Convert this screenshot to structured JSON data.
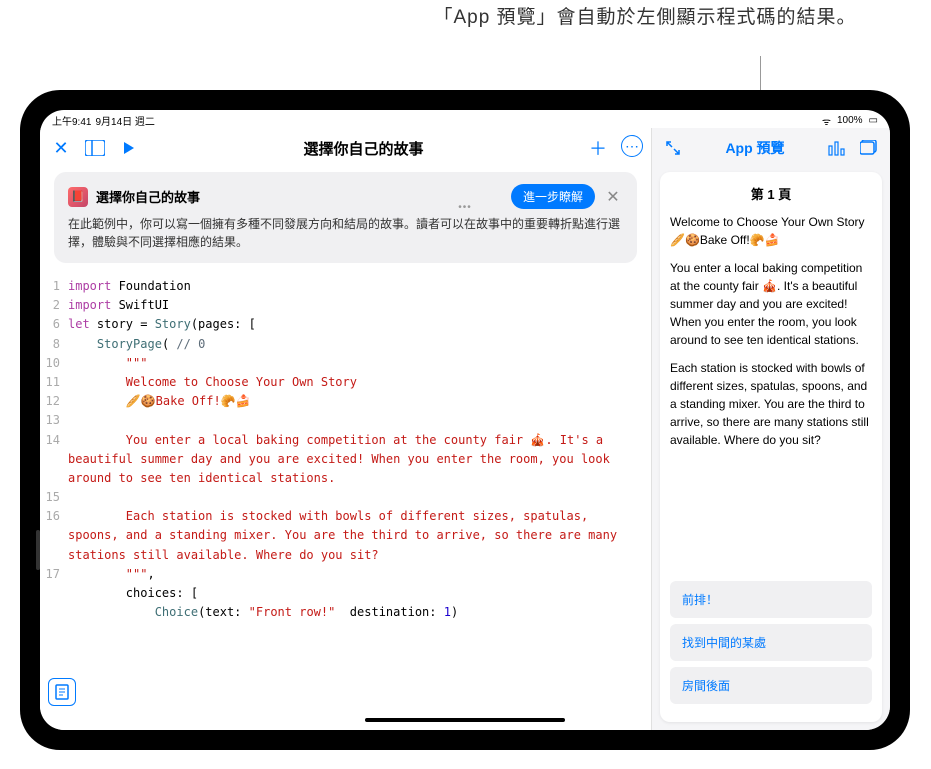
{
  "callout": {
    "text": "「App 預覽」會自動於左側顯示程式碼的結果。"
  },
  "statusBar": {
    "time": "上午9:41",
    "date": "9月14日 週二",
    "battery": "100%"
  },
  "editor": {
    "title": "選擇你自己的故事",
    "infoCard": {
      "title": "選擇你自己的故事",
      "learnMore": "進一步瞭解",
      "description": "在此範例中，你可以寫一個擁有多種不同發展方向和結局的故事。讀者可以在故事中的重要轉折點進行選擇，體驗與不同選擇相應的結果。"
    },
    "code": {
      "lines": [
        {
          "n": "1",
          "tokens": [
            {
              "t": "import ",
              "c": "kw"
            },
            {
              "t": "Foundation",
              "c": ""
            }
          ]
        },
        {
          "n": "2",
          "tokens": [
            {
              "t": "import ",
              "c": "kw"
            },
            {
              "t": "SwiftUI",
              "c": ""
            }
          ]
        },
        {
          "n": "",
          "tokens": []
        },
        {
          "n": "6",
          "tokens": [
            {
              "t": "let ",
              "c": "kw"
            },
            {
              "t": "story = ",
              "c": ""
            },
            {
              "t": "Story",
              "c": "typ"
            },
            {
              "t": "(pages: [",
              "c": ""
            }
          ]
        },
        {
          "n": "8",
          "tokens": [
            {
              "t": "    ",
              "c": ""
            },
            {
              "t": "StoryPage",
              "c": "typ"
            },
            {
              "t": "( ",
              "c": ""
            },
            {
              "t": "// 0",
              "c": "cmt"
            }
          ]
        },
        {
          "n": "10",
          "tokens": [
            {
              "t": "        ",
              "c": ""
            },
            {
              "t": "\"\"\"",
              "c": "str"
            }
          ]
        },
        {
          "n": "11",
          "tokens": [
            {
              "t": "        ",
              "c": ""
            },
            {
              "t": "Welcome to Choose Your Own Story",
              "c": "str"
            }
          ]
        },
        {
          "n": "12",
          "tokens": [
            {
              "t": "        ",
              "c": ""
            },
            {
              "t": "🥖🍪Bake Off!🥐🍰",
              "c": "str"
            }
          ]
        },
        {
          "n": "13",
          "tokens": []
        },
        {
          "n": "14",
          "tokens": [
            {
              "t": "        ",
              "c": ""
            },
            {
              "t": "You enter a local baking competition at the county fair 🎪. It's a beautiful summer day and you are excited! When you enter the room, you look around to see ten identical stations.",
              "c": "str"
            }
          ]
        },
        {
          "n": "15",
          "tokens": []
        },
        {
          "n": "16",
          "tokens": [
            {
              "t": "        ",
              "c": ""
            },
            {
              "t": "Each station is stocked with bowls of different sizes, spatulas, spoons, and a standing mixer. You are the third to arrive, so there are many stations still available. Where do you sit?",
              "c": "str"
            }
          ]
        },
        {
          "n": "17",
          "tokens": [
            {
              "t": "        ",
              "c": ""
            },
            {
              "t": "\"\"\"",
              "c": "str"
            },
            {
              "t": ",",
              "c": ""
            }
          ]
        },
        {
          "n": "",
          "tokens": [
            {
              "t": "        choices: [",
              "c": ""
            }
          ]
        },
        {
          "n": "",
          "tokens": [
            {
              "t": "            ",
              "c": ""
            },
            {
              "t": "Choice",
              "c": "typ"
            },
            {
              "t": "(text: ",
              "c": ""
            },
            {
              "t": "\"Front row!\"",
              "c": "str"
            },
            {
              "t": "  destination: ",
              "c": ""
            },
            {
              "t": "1",
              "c": "num"
            },
            {
              "t": ")",
              "c": ""
            }
          ]
        }
      ]
    }
  },
  "preview": {
    "title": "App 預覽",
    "pageHeader": "第 1 頁",
    "para1": "Welcome to Choose Your Own Story 🥖🍪Bake Off!🥐🍰",
    "para2": "You enter a local baking competition at the county fair 🎪. It's a beautiful summer day and you are excited! When you enter the room, you look around to see ten identical stations.",
    "para3": "Each station is stocked with bowls of different sizes, spatulas, spoons, and a standing mixer. You are the third to arrive, so there are many stations still available. Where do you sit?",
    "choices": [
      "前排！",
      "找到中間的某處",
      "房間後面"
    ]
  },
  "icons": {
    "close": "✕",
    "sidebar": "☰",
    "play": "▶",
    "add": "＋",
    "more": "⋯",
    "expand": "↖↘",
    "results": "📊",
    "viewMode": "⎘",
    "doc": "📄",
    "wifi": "📶",
    "battery": "🔋"
  }
}
